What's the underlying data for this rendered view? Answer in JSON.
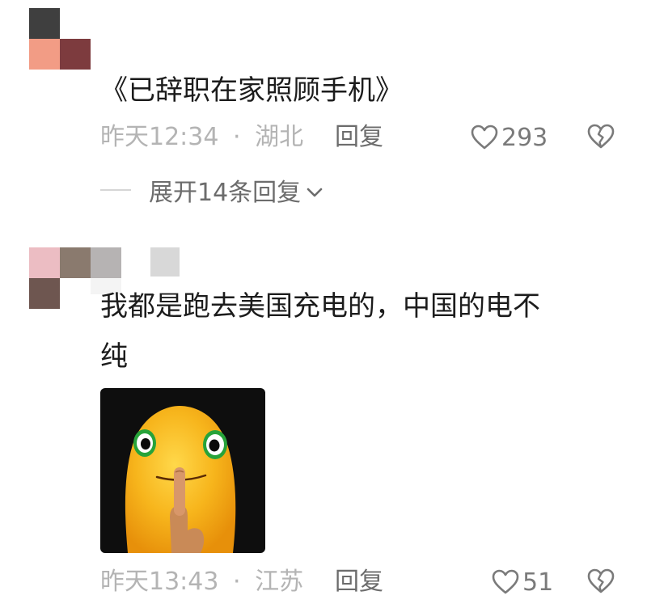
{
  "comments": [
    {
      "text": "《已辞职在家照顾手机》",
      "time": "昨天12:34",
      "separator": "·",
      "location": "湖北",
      "reply_label": "回复",
      "like_count": "293",
      "expand_label": "展开14条回复"
    },
    {
      "text_line1": "我都是跑去美国充电的，中国的电不",
      "text_line2": "纯",
      "time": "昨天13:43",
      "separator": "·",
      "location": "江苏",
      "reply_label": "回复",
      "like_count": "51"
    }
  ],
  "icons": {
    "like": "heart-outline-icon",
    "dislike": "broken-heart-icon",
    "expand": "chevron-down-icon"
  },
  "colors": {
    "meta_text": "#b4b4b4",
    "action_text": "#6c6c6c",
    "sticker_bg": "#0e0e0e",
    "sticker_character": "#f5b81a"
  }
}
